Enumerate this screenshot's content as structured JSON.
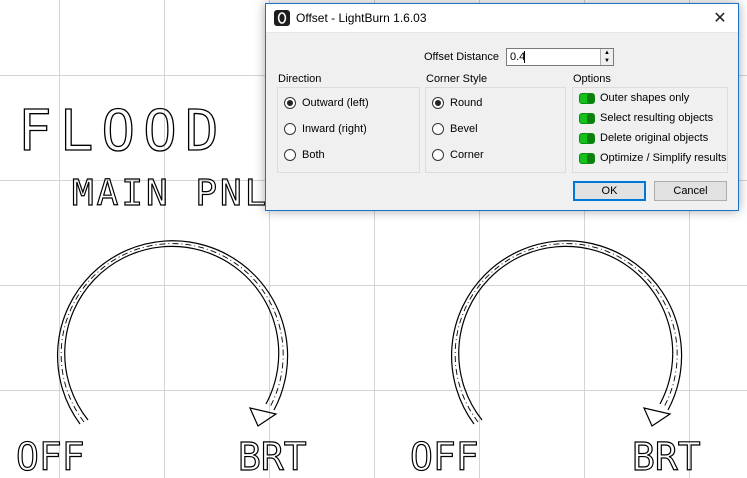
{
  "window": {
    "title": "Offset - LightBurn 1.6.03",
    "close_glyph": "✕"
  },
  "offset_distance": {
    "label": "Offset Distance",
    "value": "0.4"
  },
  "direction": {
    "label": "Direction",
    "options": [
      {
        "label": "Outward (left)",
        "selected": true
      },
      {
        "label": "Inward (right)",
        "selected": false
      },
      {
        "label": "Both",
        "selected": false
      }
    ]
  },
  "corner_style": {
    "label": "Corner Style",
    "options": [
      {
        "label": "Round",
        "selected": true
      },
      {
        "label": "Bevel",
        "selected": false
      },
      {
        "label": "Corner",
        "selected": false
      }
    ]
  },
  "options": {
    "label": "Options",
    "items": [
      {
        "label": "Outer shapes only",
        "enabled": true
      },
      {
        "label": "Select resulting objects",
        "enabled": true
      },
      {
        "label": "Delete original objects",
        "enabled": true
      },
      {
        "label": "Optimize / Simplify results",
        "enabled": true
      }
    ]
  },
  "buttons": {
    "ok": "OK",
    "cancel": "Cancel"
  },
  "canvas": {
    "heading": "FLOOD L",
    "subheading": "MAIN PNL",
    "knob_left": {
      "off_label": "OFF",
      "brt_label": "BRT"
    },
    "knob_right": {
      "off_label": "OFF",
      "brt_label": "BRT"
    }
  },
  "colors": {
    "accent": "#0078d7",
    "toggle_on": "#13c11a",
    "grid": "#d4d4d4"
  }
}
